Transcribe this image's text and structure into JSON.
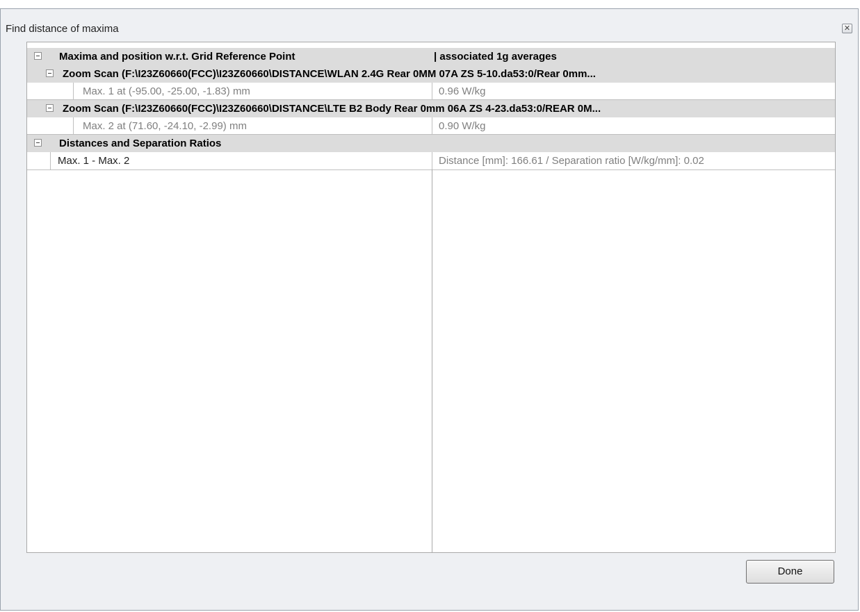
{
  "window": {
    "title": "Find distance of maxima",
    "close_glyph": "✕"
  },
  "tree": {
    "header": {
      "left_label": "Maxima and position w.r.t. Grid Reference Point",
      "right_label": "| associated 1g averages"
    },
    "scan1": {
      "label": "Zoom Scan (F:\\I23Z60660(FCC)\\I23Z60660\\DISTANCE\\WLAN 2.4G Rear 0MM  07A ZS 5-10.da53:0/Rear 0mm...",
      "max_label": "Max. 1 at (-95.00, -25.00, -1.83) mm",
      "max_value": "0.96 W/kg"
    },
    "scan2": {
      "label": "Zoom Scan (F:\\I23Z60660(FCC)\\I23Z60660\\DISTANCE\\LTE B2 Body Rear 0mm 06A ZS 4-23.da53:0/REAR 0M...",
      "max_label": "Max. 2 at (71.60, -24.10, -2.99) mm",
      "max_value": "0.90 W/kg"
    },
    "distances": {
      "label": "Distances and Separation Ratios",
      "pair_label": "Max. 1 - Max. 2",
      "pair_value": "Distance [mm]: 166.61 / Separation ratio [W/kg/mm]: 0.02"
    }
  },
  "buttons": {
    "done": "Done"
  }
}
